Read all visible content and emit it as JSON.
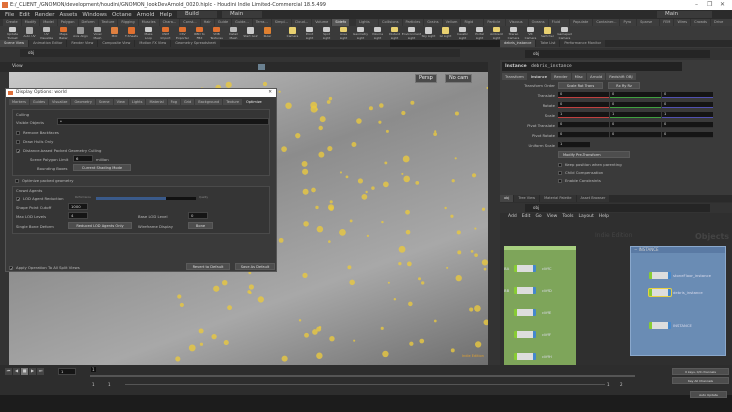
{
  "window": {
    "title": "E:/_CLIENT_/GNOMON/development/houdini/GNOMON_lookDevArnold_0020.hiplc - Houdini Indie Limited-Commercial 18.5.499",
    "minimize": "–",
    "maximize": "❐",
    "close": "✕"
  },
  "menu": {
    "items": [
      "File",
      "Edit",
      "Render",
      "Assets",
      "Windows",
      "Octane",
      "Arnold",
      "Help"
    ],
    "desktop": "Build",
    "desktop2": "Main",
    "right_desktop": "Main"
  },
  "shelf_tabs": [
    "Create",
    "Modify",
    "Model",
    "Polygon",
    "Deform",
    "Texture",
    "Rigging",
    "Muscles",
    "Chara...",
    "Const...",
    "Hair",
    "Guide",
    "Guide...",
    "Terra...",
    "Simpl...",
    "Cloud...",
    "Volume",
    "Sidefx"
  ],
  "shelf_tabs_right": [
    "Lights and...",
    "Collisions",
    "Particles",
    "Grains",
    "Vellum",
    "Rigid Bodies",
    "Particle Fl...",
    "Viscous Fl...",
    "Oceans",
    "Fluid Con...",
    "Populate C...",
    "Container...",
    "Pyro FX",
    "Sparse Pyr...",
    "FEM",
    "Wires",
    "Crowds",
    "Drive Sim..."
  ],
  "shelf_tools": [
    "Update Toolset",
    "Auto UV",
    "UV Visualize",
    "Maps Baker",
    "Axis Align",
    "Voxel Mesh",
    "MiO",
    "T-Sheets",
    "Make Loop",
    "OSM Import",
    "CSV Exporter",
    "RBD to FBX",
    "VDB Textures",
    "Detail Mesh",
    "Start Go2",
    "Ruler"
  ],
  "shelf_tools_right": [
    "Camera",
    "Point Light",
    "Spot Light",
    "Area Light",
    "Geometry Light",
    "Volume Light",
    "Distant Light",
    "Environment Light",
    "Sky Light",
    "GI Light",
    "Caustic Light",
    "Portal Light",
    "Ambient Light",
    "Stereo Camera",
    "VR Camera",
    "Switcher",
    "Gamepad Camera"
  ],
  "pane_tabs": [
    "Scene View",
    "Animation Editor",
    "Render View",
    "Composite View",
    "Motion FX View",
    "Geometry Spreadsheet"
  ],
  "path": "obj",
  "viewport": {
    "label": "View",
    "persp": "Persp",
    "cam": "No cam",
    "watermark": "Indie Edition"
  },
  "dialog": {
    "title": "Display Options: world",
    "tabs": [
      "Markers",
      "Guides",
      "Visualize",
      "Geometry",
      "Scene",
      "View",
      "Lights",
      "Material",
      "Fog",
      "Grid",
      "Background",
      "Texture",
      "Optimize"
    ],
    "active_tab": "Optimize",
    "culling": {
      "header": "Culling",
      "visible_objects_label": "Visible Objects",
      "visible_objects": "*",
      "remove_backfaces": "Remove Backfaces",
      "draw_hulls": "Draw Hulls Only",
      "distance_culling": "Distance-based Packed Geometry Culling",
      "poly_limit_label": "Scene Polygon Limit",
      "poly_limit": "6",
      "poly_unit": "million",
      "bbox_label": "Bounding Boxes",
      "bbox_value": "Current Shading Mode",
      "optimize_packed": "Optimize packed geometry"
    },
    "crowd": {
      "header": "Crowd Agents",
      "lod_reduction": "LOD Agent Reduction",
      "slider_left": "Performance",
      "slider_right": "Quality",
      "slider_value": 0.7,
      "shape_cutoff_label": "Shape Point Cutoff",
      "shape_cutoff": "1000",
      "max_lod_label": "Max LOD Levels",
      "max_lod": "4",
      "base_lod_label": "Base LOD Level",
      "base_lod": "0",
      "bone_deform_label": "Single Bone Deform",
      "bone_deform": "Reduced LOD Agents Only",
      "wire_label": "Wireframe Display",
      "wire": "Bone"
    },
    "apply_all": "Apply Operation To All Split Views",
    "revert": "Revert to Default",
    "save": "Save As Default"
  },
  "params": {
    "tabs": [
      "debris_instance",
      "Take List",
      "Performance Monitor"
    ],
    "node_type": "Instance",
    "node_name": "debris_instance",
    "param_tabs": [
      "Transform",
      "Instance",
      "Render",
      "Misc",
      "Arnold",
      "Redshift OBJ"
    ],
    "active_param_tab": "Instance",
    "rows": [
      {
        "label": "Transform Order",
        "values": [
          "Scale Rot Trans",
          "Rx Ry Rz"
        ]
      },
      {
        "label": "Translate",
        "values": [
          "0",
          "0",
          "0"
        ]
      },
      {
        "label": "Rotate",
        "values": [
          "0",
          "0",
          "0"
        ]
      },
      {
        "label": "Scale",
        "values": [
          "1",
          "1",
          "1"
        ]
      },
      {
        "label": "Pivot Translate",
        "values": [
          "0",
          "0",
          "0"
        ]
      },
      {
        "label": "Pivot Rotate",
        "values": [
          "0",
          "0",
          "0"
        ]
      },
      {
        "label": "Uniform Scale",
        "values": [
          "1"
        ]
      }
    ],
    "modify_menu": "Modify Pre-Transform",
    "checks": [
      "Keep position when parenting",
      "Child Compensation",
      "Enable Constraints"
    ]
  },
  "network": {
    "tabs": [
      "obj",
      "Tree View",
      "Material Palette",
      "Asset Browser"
    ],
    "menu": [
      "Add",
      "Edit",
      "Go",
      "View",
      "Tools",
      "Layout",
      "Help"
    ],
    "watermark1": "Indie Edition",
    "watermark2": "Objects",
    "left_nodes": [
      "cliffC",
      "cliffD",
      "cliffE",
      "cliffF",
      "cliffH"
    ],
    "left_side_labels": [
      "BA",
      "BB"
    ],
    "box_title": "INSTANCE",
    "box_nodes": [
      "stoneFloor_instance",
      "debris_instance",
      "INSTANCE"
    ]
  },
  "timeline": {
    "frame": "1",
    "start": "1",
    "start2": "1",
    "end": "1",
    "end2": "2",
    "keys": "0 keys, 0/0 channels",
    "key_all": "Key All Channels",
    "auto_update": "Auto Update"
  },
  "colors": {
    "accent": "#e0a030",
    "net_box": "#6a8cb4",
    "net_green": "#7ea55a",
    "debris": "#e8c840"
  }
}
